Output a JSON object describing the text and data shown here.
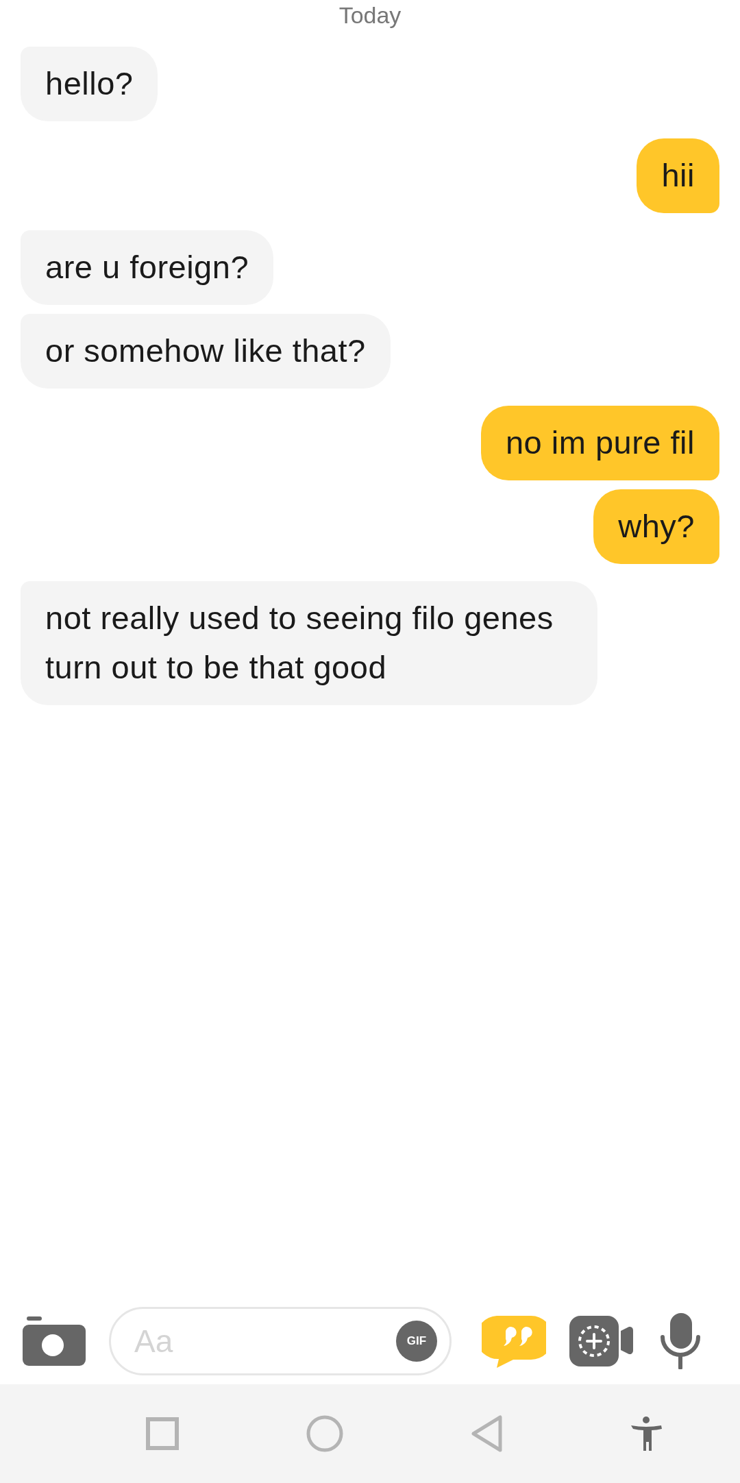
{
  "date_divider": "Today",
  "messages": [
    {
      "text": "hello?",
      "kind": "received"
    },
    {
      "text": "hii",
      "kind": "sent"
    },
    {
      "text": "are u foreign?",
      "kind": "received"
    },
    {
      "text": "or somehow like that?",
      "kind": "received"
    },
    {
      "text": "no im pure fil",
      "kind": "sent"
    },
    {
      "text": "why?",
      "kind": "sent"
    },
    {
      "text": "not really used to seeing filo genes turn out to be that good",
      "kind": "received"
    }
  ],
  "composer": {
    "placeholder": "Aa",
    "gif_label": "GIF"
  }
}
